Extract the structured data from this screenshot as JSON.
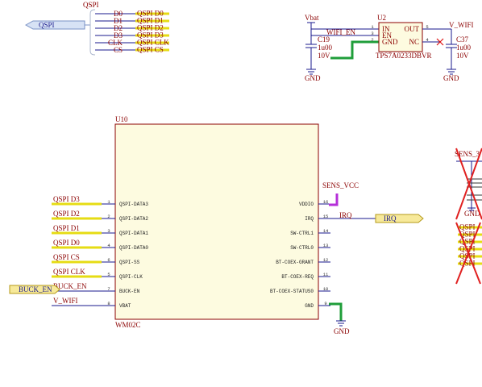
{
  "qspi_bus": {
    "label": "QSPI",
    "port_label": "QSPI",
    "signals": [
      "D0",
      "D1",
      "D2",
      "D3",
      "CLK",
      "CS"
    ],
    "nets": [
      "QSPI D0",
      "QSPI D1",
      "QSPI D2",
      "QSPI D3",
      "QSPI CLK",
      "QSPI CS"
    ]
  },
  "regulator": {
    "ref": "U2",
    "part": "TPS7A0233DBVR",
    "pins": [
      {
        "num": "1",
        "name": "IN"
      },
      {
        "num": "3",
        "name": "EN"
      },
      {
        "num": "2",
        "name": "GND"
      },
      {
        "num": "5",
        "name": "OUT"
      },
      {
        "num": "4",
        "name": "NC"
      }
    ],
    "in_net": "Vbat",
    "en_net": "WIFI_EN",
    "out_net": "V_WIFI",
    "cap_in": {
      "ref": "C19",
      "value": "1u00",
      "voltage": "10V"
    },
    "cap_out": {
      "ref": "C37",
      "value": "1u00",
      "voltage": "10V"
    },
    "gnd": "GND"
  },
  "module": {
    "ref": "U10",
    "part": "WM02C",
    "left_pins": [
      {
        "num": "1",
        "name": "QSPI-DATA3",
        "net": "QSPI D3"
      },
      {
        "num": "2",
        "name": "QSPI-DATA2",
        "net": "QSPI D2"
      },
      {
        "num": "3",
        "name": "QSPI-DATA1",
        "net": "QSPI D1"
      },
      {
        "num": "4",
        "name": "QSPI-DATA0",
        "net": "QSPI D0"
      },
      {
        "num": "6",
        "name": "QSPI-SS",
        "net": "QSPI CS"
      },
      {
        "num": "5",
        "name": "QSPI-CLK",
        "net": "QSPI CLK"
      },
      {
        "num": "7",
        "name": "BUCK-EN",
        "net": "BUCK_EN"
      },
      {
        "num": "8",
        "name": "VBAT",
        "net": "V_WIFI"
      }
    ],
    "right_pins": [
      {
        "num": "16",
        "name": "VDDIO"
      },
      {
        "num": "15",
        "name": "IRQ"
      },
      {
        "num": "14",
        "name": "SW-CTRL1"
      },
      {
        "num": "13",
        "name": "SW-CTRL0"
      },
      {
        "num": "12",
        "name": "BT-COEX-GRANT"
      },
      {
        "num": "11",
        "name": "BT-COEX-REQ"
      },
      {
        "num": "10",
        "name": "BT-COEX-STATUS0"
      },
      {
        "num": "9",
        "name": "GND"
      }
    ],
    "vddio_net": "SENS_VCC",
    "irq_net": "IRQ",
    "irq_port": "IRQ",
    "buck_port": "BUCK_EN",
    "gnd": "GND"
  },
  "crossed_block": {
    "net": "SENS_3",
    "gnd": "GND",
    "labels": [
      "QSPI",
      "QSPI",
      "QSPI",
      "QSPI",
      "QSPI",
      "QSPI"
    ]
  }
}
